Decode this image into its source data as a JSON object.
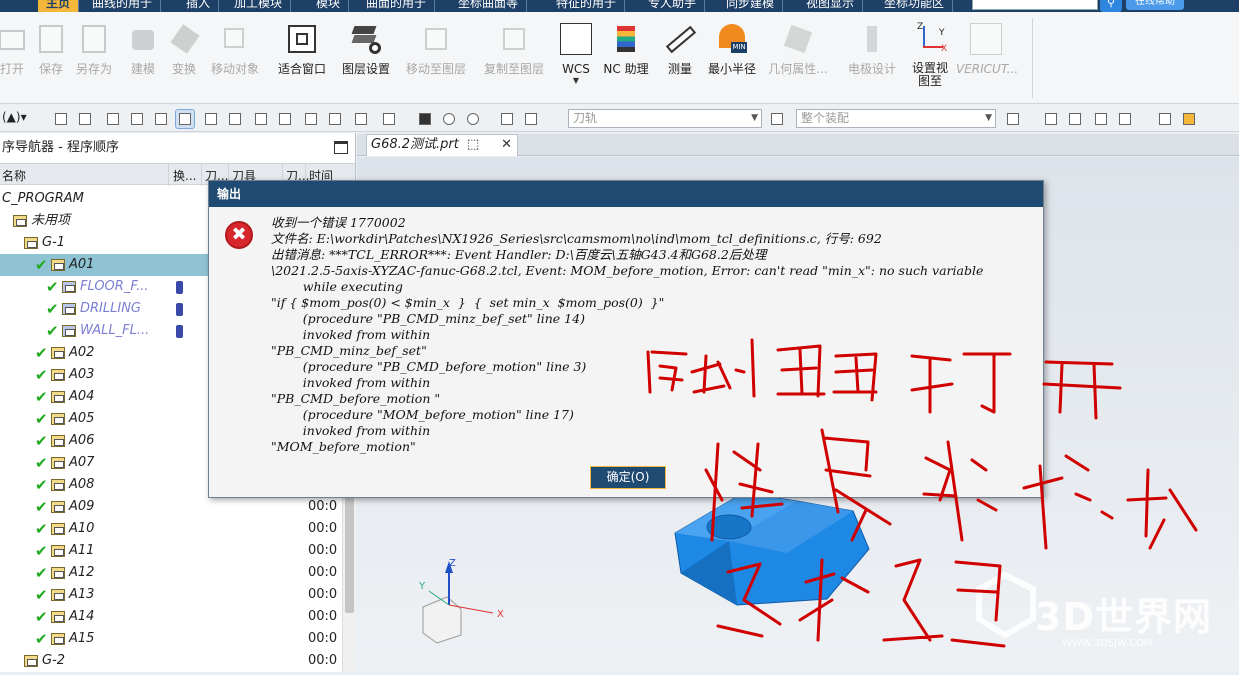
{
  "menubar": {
    "tabs": [
      "主页",
      "曲线的用于",
      "插入",
      "加工模块",
      "模块",
      "曲面的用于",
      "坐标曲面等",
      "特征的用于",
      "专人助手",
      "同步建模",
      "视图显示",
      "坐标功能区"
    ],
    "active_index": 0,
    "search_placeholder": "",
    "online_label": "在线帮助"
  },
  "ribbon": {
    "buttons": [
      {
        "label": "打开",
        "enabled": false
      },
      {
        "label": "保存",
        "enabled": false
      },
      {
        "label": "另存为",
        "enabled": false
      },
      {
        "label": "建模",
        "enabled": false
      },
      {
        "label": "变换",
        "enabled": false
      },
      {
        "label": "移动对象",
        "enabled": false
      },
      {
        "label": "适合窗口",
        "enabled": true
      },
      {
        "label": "图层设置",
        "enabled": true
      },
      {
        "label": "移动至图层",
        "enabled": false
      },
      {
        "label": "复制至图层",
        "enabled": false
      },
      {
        "label": "WCS",
        "enabled": true
      },
      {
        "label": "NC 助理",
        "enabled": true
      },
      {
        "label": "测量",
        "enabled": true
      },
      {
        "label": "最小半径",
        "enabled": true
      },
      {
        "label": "几何属性...",
        "enabled": false
      },
      {
        "label": "电极设计",
        "enabled": false
      },
      {
        "label": "设置视图至",
        "enabled": true
      },
      {
        "label": "VERICUT...",
        "enabled": false
      }
    ]
  },
  "toolbar2": {
    "tool_combo": "刀轨",
    "assembly_combo": "整个装配"
  },
  "navigator": {
    "title": "序导航器 - 程序顺序",
    "columns": [
      "名称",
      "换...",
      "刀...",
      "刀具",
      "刀...",
      "时间"
    ],
    "rows": [
      {
        "indent": 0,
        "label": "C_PROGRAM",
        "check": false,
        "folder": false,
        "time": ""
      },
      {
        "indent": 1,
        "label": "未用项",
        "check": false,
        "folder": true,
        "time": ""
      },
      {
        "indent": 2,
        "label": "G-1",
        "check": false,
        "folder": true,
        "time": ""
      },
      {
        "indent": 3,
        "label": "A01",
        "check": true,
        "folder": true,
        "time": "",
        "selected": true
      },
      {
        "indent": 4,
        "label": "FLOOR_F...",
        "check": true,
        "op": true,
        "time": ""
      },
      {
        "indent": 4,
        "label": "DRILLING",
        "check": true,
        "op": true,
        "time": ""
      },
      {
        "indent": 4,
        "label": "WALL_FL...",
        "check": true,
        "op": true,
        "time": ""
      },
      {
        "indent": 3,
        "label": "A02",
        "check": true,
        "folder": true,
        "time": ""
      },
      {
        "indent": 3,
        "label": "A03",
        "check": true,
        "folder": true,
        "time": ""
      },
      {
        "indent": 3,
        "label": "A04",
        "check": true,
        "folder": true,
        "time": ""
      },
      {
        "indent": 3,
        "label": "A05",
        "check": true,
        "folder": true,
        "time": ""
      },
      {
        "indent": 3,
        "label": "A06",
        "check": true,
        "folder": true,
        "time": ""
      },
      {
        "indent": 3,
        "label": "A07",
        "check": true,
        "folder": true,
        "time": ""
      },
      {
        "indent": 3,
        "label": "A08",
        "check": true,
        "folder": true,
        "time": ""
      },
      {
        "indent": 3,
        "label": "A09",
        "check": true,
        "folder": true,
        "time": "00:0"
      },
      {
        "indent": 3,
        "label": "A10",
        "check": true,
        "folder": true,
        "time": "00:0"
      },
      {
        "indent": 3,
        "label": "A11",
        "check": true,
        "folder": true,
        "time": "00:0"
      },
      {
        "indent": 3,
        "label": "A12",
        "check": true,
        "folder": true,
        "time": "00:0"
      },
      {
        "indent": 3,
        "label": "A13",
        "check": true,
        "folder": true,
        "time": "00:0"
      },
      {
        "indent": 3,
        "label": "A14",
        "check": true,
        "folder": true,
        "time": "00:0"
      },
      {
        "indent": 3,
        "label": "A15",
        "check": true,
        "folder": true,
        "time": "00:0"
      },
      {
        "indent": 2,
        "label": "G-2",
        "check": false,
        "folder": true,
        "time": "00:0"
      }
    ]
  },
  "viewport": {
    "tab_label": "G68.2测试.prt",
    "tab_marker": "⬚",
    "tab_close": "✕",
    "axis_x": "X",
    "axis_y": "Y",
    "axis_z": "Z"
  },
  "dialog": {
    "title": "输出",
    "error_glyph": "✖",
    "lines": [
      "收到一个错误 1770002",
      "文件名: E:\\workdir\\Patches\\NX1926_Series\\src\\camsmom\\no\\ind\\mom_tcl_definitions.c, 行号: 692",
      "出错消息: ***TCL_ERROR***: Event Handler: D:\\百度云\\五轴G43.4和G68.2后处理",
      "\\2021.2.5-5axis-XYZAC-fanuc-G68.2.tcl, Event: MOM_before_motion, Error: can't read \"min_x\": no such variable",
      "        while executing",
      "\"if { $mom_pos(0) < $min_x  }  {  set min_x  $mom_pos(0)  }\"",
      "        (procedure \"PB_CMD_minz_bef_set\" line 14)",
      "        invoked from within",
      "\"PB_CMD_minz_bef_set\"",
      "        (procedure \"PB_CMD_before_motion\" line 3)",
      "        invoked from within",
      "\"PB_CMD_before_motion \"",
      "        (procedure \"MOM_before_motion\" line 17)",
      "        invoked from within",
      "\"MOM_before_motion\""
    ],
    "ok_label": "确定(O)"
  },
  "watermark": {
    "text": "3D世界网",
    "url": "WWW.3DSJW.COM"
  },
  "colors": {
    "title_bar": "#1f4a72",
    "accent": "#f4b73b",
    "model_blue": "#1e88e5",
    "annotation_red": "#d10000"
  }
}
